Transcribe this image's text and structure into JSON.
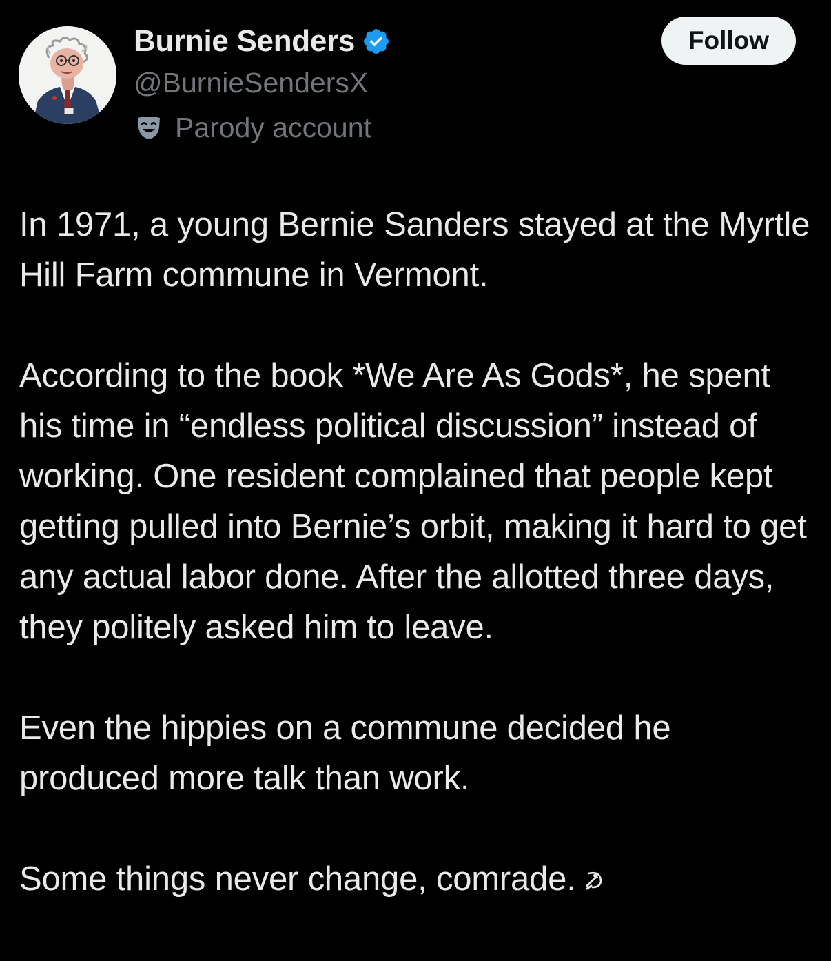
{
  "author": {
    "display_name": "Burnie Senders",
    "handle": "@BurnieSendersX",
    "parody_label": "Parody account",
    "verified_icon": "verified-badge-icon",
    "parody_icon": "theater-mask-icon",
    "badge_color": "#1d9bf0"
  },
  "actions": {
    "follow_label": "Follow"
  },
  "post": {
    "paragraphs": [
      "In 1971, a young Bernie Sanders stayed at the Myrtle Hill Farm commune in Vermont.",
      "According to the book *We Are As Gods*, he spent his time in “endless political discussion” instead of working. One resident complained that people kept getting pulled into Bernie’s orbit, making it hard to get any actual labor done. After the allotted three days, they politely asked him to leave.",
      "Even the hippies on a commune decided he produced more talk than work.",
      "Some things never change, comrade."
    ],
    "trailing_emoji": "hammer-and-sickle-icon"
  },
  "colors": {
    "background": "#000000",
    "text_primary": "#e7e9ea",
    "text_secondary": "#71767b",
    "follow_bg": "#eff3f4",
    "follow_text": "#0f1419"
  }
}
